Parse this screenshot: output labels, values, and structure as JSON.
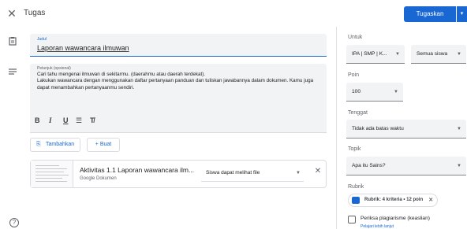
{
  "header": {
    "title": "Tugas",
    "assign_label": "Tugaskan"
  },
  "form": {
    "title_label": "Judul",
    "title_value": "Laporan wawancara ilmuwan",
    "desc_label": "Petunjuk (opsional)",
    "desc_value": "Cari tahu mengenai ilmuwan di sekitarmu. (daerahmu atau daerah terdekat).\nLakukan wawancara dengan menggunakan daftar pertanyaan panduan dan tuliskan jawabannya dalam dokumen. Kamu juga dapat menambahkan pertanyaanmu sendiri.",
    "toolbar": {
      "bold": "B",
      "italic": "I",
      "underline": "U",
      "list": "☰",
      "clear": "T̸"
    },
    "add_label": "Tambahkan",
    "create_label": "+ Buat"
  },
  "attachment": {
    "title": "Aktivitas 1.1 Laporan wawancara ilm...",
    "type": "Google Dokumen",
    "permission": "Siswa dapat melihat file"
  },
  "sidebar": {
    "for_label": "Untuk",
    "class_value": "IPA | SMP | K...",
    "students_value": "Semua siswa",
    "points_label": "Poin",
    "points_value": "100",
    "due_label": "Tenggat",
    "due_value": "Tidak ada batas waktu",
    "topic_label": "Topik",
    "topic_value": "Apa itu Sains?",
    "rubric_label": "Rubrik",
    "rubric_chip": "Rubrik: 4 kriteria • 12 poin",
    "plagiarism_label": "Periksa plagiarisme (keaslian)",
    "learn_more": "Pelajari lebih lanjut"
  },
  "colors": {
    "accent": "#1967d2",
    "field_bg": "#f1f3f4"
  }
}
